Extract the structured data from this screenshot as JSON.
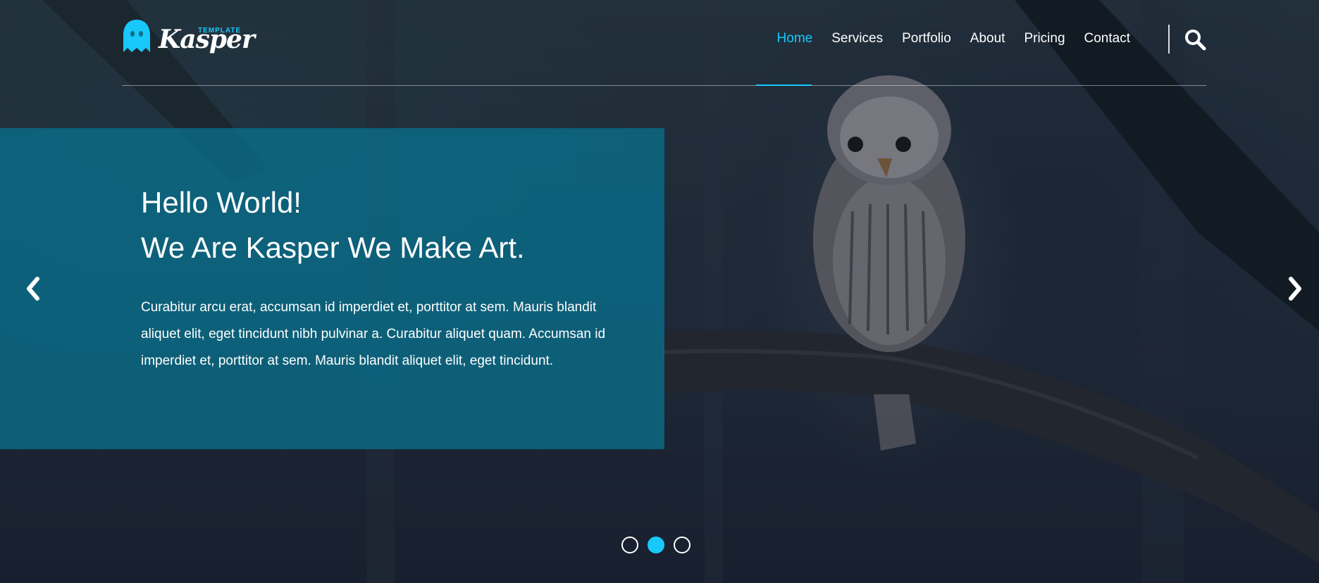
{
  "brand": {
    "name": "Kasper",
    "tagline": "TEMPLATE",
    "icon": "ghost-icon",
    "accent": "#19c8fa"
  },
  "nav": {
    "items": [
      {
        "label": "Home",
        "active": true
      },
      {
        "label": "Services",
        "active": false
      },
      {
        "label": "Portfolio",
        "active": false
      },
      {
        "label": "About",
        "active": false
      },
      {
        "label": "Pricing",
        "active": false
      },
      {
        "label": "Contact",
        "active": false
      }
    ],
    "search_icon": "search-icon"
  },
  "hero": {
    "title_line1": "Hello World!",
    "title_line2": "We Are Kasper We Make Art.",
    "body": "Curabitur arcu erat, accumsan id imperdiet et, porttitor at sem. Mauris blandit aliquet elit, eget tincidunt nibh pulvinar a. Curabitur aliquet quam. Accumsan id imperdiet et, porttitor at sem. Mauris blandit aliquet elit, eget tincidunt.",
    "panel_color": "#09708c",
    "prev_icon": "chevron-left-icon",
    "next_icon": "chevron-right-icon"
  },
  "slider": {
    "count": 3,
    "active_index": 1
  }
}
